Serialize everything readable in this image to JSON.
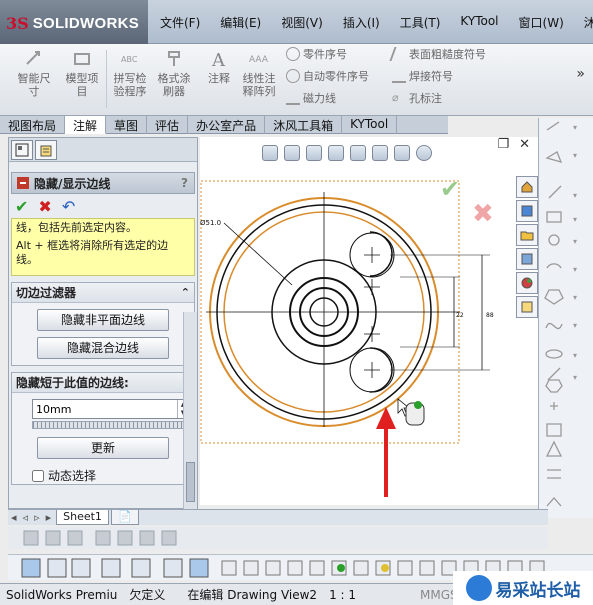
{
  "app": {
    "logo_text": "SOLIDWORKS",
    "logo_prefix": "3S"
  },
  "menu": [
    "文件(F)",
    "编辑(E)",
    "视图(V)",
    "插入(I)",
    "工具(T)",
    "KYTool",
    "窗口(W)",
    "沐风工具箱"
  ],
  "ribbon": {
    "smart_dim": "智能尺寸",
    "model_items": "模型项目",
    "spell_check": "拼写检验程序",
    "format_painter": "格式涂刷器",
    "note": "注释",
    "linear_note": "线性注释阵列",
    "balloon": "零件序号",
    "auto_balloon": "自动零件序号",
    "magnetic_line": "磁力线",
    "surface_finish": "表面粗糙度符号",
    "weld_symbol": "焊接符号",
    "hole_callout": "孔标注",
    "more": "»"
  },
  "tabs": [
    "视图布局",
    "注解",
    "草图",
    "评估",
    "办公室产品",
    "沐风工具箱",
    "KYTool"
  ],
  "active_tab_index": 1,
  "property_manager": {
    "title": "隐藏/显示边线",
    "help": "?",
    "ok": "✔",
    "cancel": "✖",
    "undo": "↶",
    "note_text_1": "线，包括先前选定内容。",
    "note_text_2": "Alt + 框选将消除所有选定的边线。",
    "group1_title": "切边过滤器",
    "collapse1": "⌃",
    "btn_hide_nonplanar": "隐藏非平面边线",
    "btn_hide_blend": "隐藏混合边线",
    "group2_title": "隐藏短于此值的边线:",
    "collapse2": "⌃",
    "length_value": "10mm",
    "btn_update": "更新",
    "dynamic_select": "动态选择"
  },
  "drawing": {
    "win_ctrl": [
      "❐",
      "✕"
    ],
    "dim_diameter": "Ø51.0"
  },
  "sheet_tabs": {
    "sheet1": "Sheet1"
  },
  "status": {
    "product": "SolidWorks Premiu",
    "custom": "欠定义",
    "editing": "在编辑 Drawing View2",
    "scale": "1 : 1",
    "units": "MMGS"
  },
  "watermark": {
    "text": "易采站长站"
  },
  "colors": {
    "accent_orange": "#d98c2b",
    "arrow_red": "#e02020",
    "logo_red": "#c8102e"
  }
}
